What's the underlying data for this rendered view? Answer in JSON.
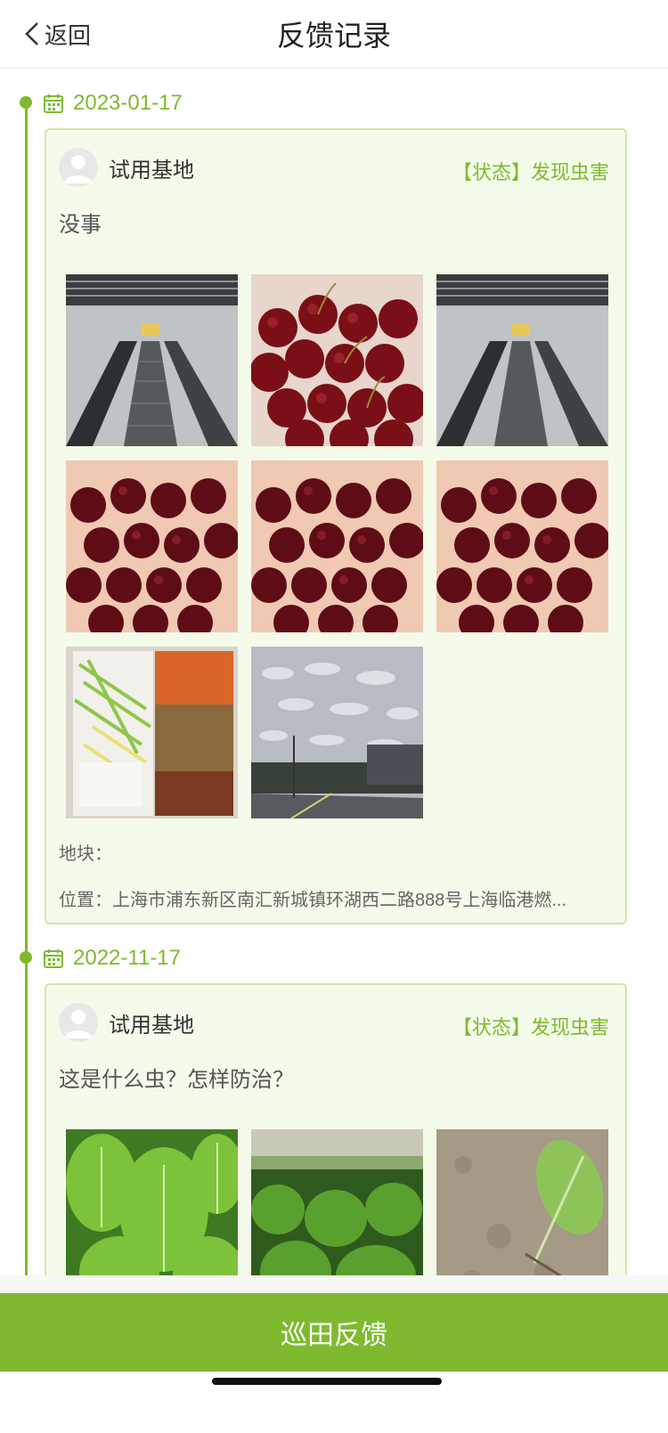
{
  "header": {
    "back_label": "返回",
    "title": "反馈记录"
  },
  "records": [
    {
      "date": "2023-01-17",
      "user": "试用基地",
      "status": "【状态】发现虫害",
      "content": "没事",
      "photos": [
        "escalator-photo",
        "cherries-photo",
        "escalator-photo",
        "cherries-photo",
        "cherries-photo",
        "cherries-photo",
        "food-tray-photo",
        "sky-street-photo"
      ],
      "plot": "地块：",
      "location": "位置：上海市浦东新区南汇新城镇环湖西二路888号上海临港燃..."
    },
    {
      "date": "2022-11-17",
      "user": "试用基地",
      "status": "【状态】发现虫害",
      "content": "这是什么虫？怎样防治？",
      "photos": [
        "leafy-greens-photo",
        "vegetable-field-photo",
        "wilted-leaf-photo"
      ]
    }
  ],
  "footer": {
    "button_label": "巡田反馈"
  },
  "colors": {
    "accent": "#7dba2f",
    "card_bg": "#f5fbea",
    "card_border": "#cde8ad"
  }
}
